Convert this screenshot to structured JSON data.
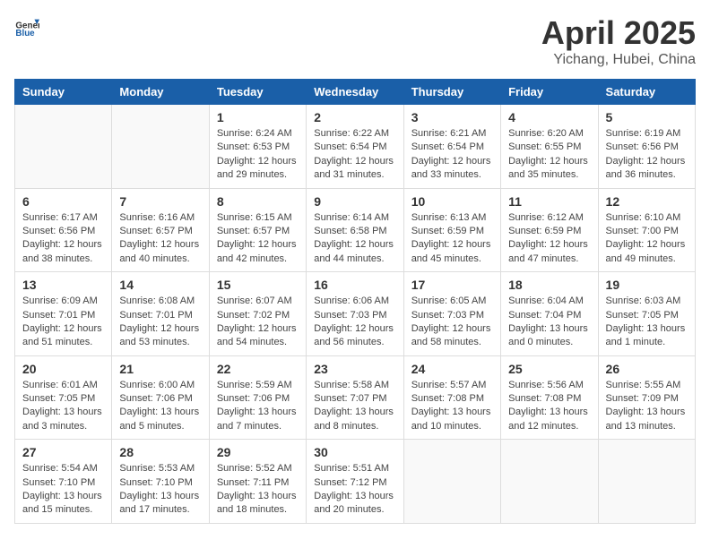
{
  "header": {
    "logo_general": "General",
    "logo_blue": "Blue",
    "month": "April 2025",
    "location": "Yichang, Hubei, China"
  },
  "weekdays": [
    "Sunday",
    "Monday",
    "Tuesday",
    "Wednesday",
    "Thursday",
    "Friday",
    "Saturday"
  ],
  "weeks": [
    [
      {
        "day": "",
        "info": ""
      },
      {
        "day": "",
        "info": ""
      },
      {
        "day": "1",
        "info": "Sunrise: 6:24 AM\nSunset: 6:53 PM\nDaylight: 12 hours\nand 29 minutes."
      },
      {
        "day": "2",
        "info": "Sunrise: 6:22 AM\nSunset: 6:54 PM\nDaylight: 12 hours\nand 31 minutes."
      },
      {
        "day": "3",
        "info": "Sunrise: 6:21 AM\nSunset: 6:54 PM\nDaylight: 12 hours\nand 33 minutes."
      },
      {
        "day": "4",
        "info": "Sunrise: 6:20 AM\nSunset: 6:55 PM\nDaylight: 12 hours\nand 35 minutes."
      },
      {
        "day": "5",
        "info": "Sunrise: 6:19 AM\nSunset: 6:56 PM\nDaylight: 12 hours\nand 36 minutes."
      }
    ],
    [
      {
        "day": "6",
        "info": "Sunrise: 6:17 AM\nSunset: 6:56 PM\nDaylight: 12 hours\nand 38 minutes."
      },
      {
        "day": "7",
        "info": "Sunrise: 6:16 AM\nSunset: 6:57 PM\nDaylight: 12 hours\nand 40 minutes."
      },
      {
        "day": "8",
        "info": "Sunrise: 6:15 AM\nSunset: 6:57 PM\nDaylight: 12 hours\nand 42 minutes."
      },
      {
        "day": "9",
        "info": "Sunrise: 6:14 AM\nSunset: 6:58 PM\nDaylight: 12 hours\nand 44 minutes."
      },
      {
        "day": "10",
        "info": "Sunrise: 6:13 AM\nSunset: 6:59 PM\nDaylight: 12 hours\nand 45 minutes."
      },
      {
        "day": "11",
        "info": "Sunrise: 6:12 AM\nSunset: 6:59 PM\nDaylight: 12 hours\nand 47 minutes."
      },
      {
        "day": "12",
        "info": "Sunrise: 6:10 AM\nSunset: 7:00 PM\nDaylight: 12 hours\nand 49 minutes."
      }
    ],
    [
      {
        "day": "13",
        "info": "Sunrise: 6:09 AM\nSunset: 7:01 PM\nDaylight: 12 hours\nand 51 minutes."
      },
      {
        "day": "14",
        "info": "Sunrise: 6:08 AM\nSunset: 7:01 PM\nDaylight: 12 hours\nand 53 minutes."
      },
      {
        "day": "15",
        "info": "Sunrise: 6:07 AM\nSunset: 7:02 PM\nDaylight: 12 hours\nand 54 minutes."
      },
      {
        "day": "16",
        "info": "Sunrise: 6:06 AM\nSunset: 7:03 PM\nDaylight: 12 hours\nand 56 minutes."
      },
      {
        "day": "17",
        "info": "Sunrise: 6:05 AM\nSunset: 7:03 PM\nDaylight: 12 hours\nand 58 minutes."
      },
      {
        "day": "18",
        "info": "Sunrise: 6:04 AM\nSunset: 7:04 PM\nDaylight: 13 hours\nand 0 minutes."
      },
      {
        "day": "19",
        "info": "Sunrise: 6:03 AM\nSunset: 7:05 PM\nDaylight: 13 hours\nand 1 minute."
      }
    ],
    [
      {
        "day": "20",
        "info": "Sunrise: 6:01 AM\nSunset: 7:05 PM\nDaylight: 13 hours\nand 3 minutes."
      },
      {
        "day": "21",
        "info": "Sunrise: 6:00 AM\nSunset: 7:06 PM\nDaylight: 13 hours\nand 5 minutes."
      },
      {
        "day": "22",
        "info": "Sunrise: 5:59 AM\nSunset: 7:06 PM\nDaylight: 13 hours\nand 7 minutes."
      },
      {
        "day": "23",
        "info": "Sunrise: 5:58 AM\nSunset: 7:07 PM\nDaylight: 13 hours\nand 8 minutes."
      },
      {
        "day": "24",
        "info": "Sunrise: 5:57 AM\nSunset: 7:08 PM\nDaylight: 13 hours\nand 10 minutes."
      },
      {
        "day": "25",
        "info": "Sunrise: 5:56 AM\nSunset: 7:08 PM\nDaylight: 13 hours\nand 12 minutes."
      },
      {
        "day": "26",
        "info": "Sunrise: 5:55 AM\nSunset: 7:09 PM\nDaylight: 13 hours\nand 13 minutes."
      }
    ],
    [
      {
        "day": "27",
        "info": "Sunrise: 5:54 AM\nSunset: 7:10 PM\nDaylight: 13 hours\nand 15 minutes."
      },
      {
        "day": "28",
        "info": "Sunrise: 5:53 AM\nSunset: 7:10 PM\nDaylight: 13 hours\nand 17 minutes."
      },
      {
        "day": "29",
        "info": "Sunrise: 5:52 AM\nSunset: 7:11 PM\nDaylight: 13 hours\nand 18 minutes."
      },
      {
        "day": "30",
        "info": "Sunrise: 5:51 AM\nSunset: 7:12 PM\nDaylight: 13 hours\nand 20 minutes."
      },
      {
        "day": "",
        "info": ""
      },
      {
        "day": "",
        "info": ""
      },
      {
        "day": "",
        "info": ""
      }
    ]
  ]
}
